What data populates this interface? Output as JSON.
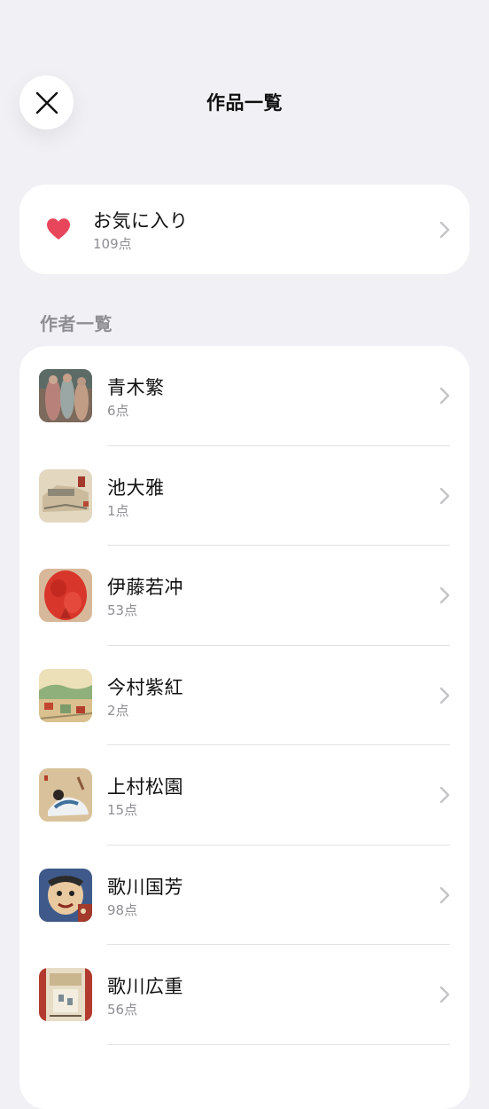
{
  "header": {
    "title": "作品一覧",
    "close_icon": "close-icon"
  },
  "favorites": {
    "title": "お気に入り",
    "count": "109点",
    "icon": "heart-icon",
    "icon_color": "#e8475b"
  },
  "section": {
    "label": "作者一覧"
  },
  "artists": [
    {
      "name": "青木繁",
      "count": "6点"
    },
    {
      "name": "池大雅",
      "count": "1点"
    },
    {
      "name": "伊藤若冲",
      "count": "53点"
    },
    {
      "name": "今村紫紅",
      "count": "2点"
    },
    {
      "name": "上村松園",
      "count": "15点"
    },
    {
      "name": "歌川国芳",
      "count": "98点"
    },
    {
      "name": "歌川広重",
      "count": "56点"
    }
  ],
  "colors": {
    "background": "#f1f0f5",
    "card": "#ffffff",
    "secondary_text": "#8e8e93",
    "chevron": "#c4c4c7"
  }
}
